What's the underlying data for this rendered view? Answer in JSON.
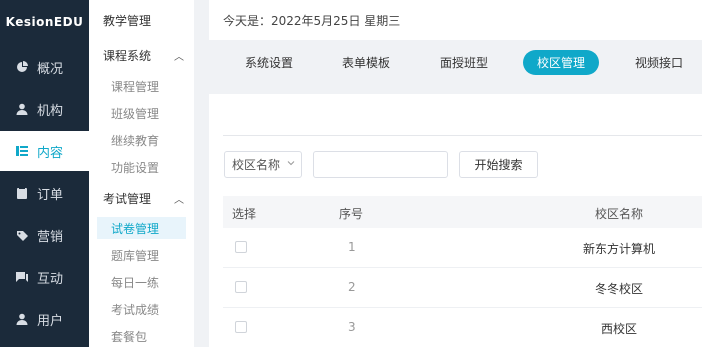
{
  "brand": "KesionEDU",
  "rail": [
    {
      "label": "概况",
      "icon": "dashboard-icon"
    },
    {
      "label": "机构",
      "icon": "user-icon"
    },
    {
      "label": "内容",
      "icon": "content-icon",
      "active": true
    },
    {
      "label": "订单",
      "icon": "order-icon"
    },
    {
      "label": "营销",
      "icon": "marketing-icon"
    },
    {
      "label": "互动",
      "icon": "chat-icon"
    },
    {
      "label": "用户",
      "icon": "user-icon"
    }
  ],
  "submenu": {
    "top_label": "教学管理",
    "groups": [
      {
        "label": "课程系统",
        "items": [
          "课程管理",
          "班级管理",
          "继续教育",
          "功能设置"
        ]
      },
      {
        "label": "考试管理",
        "items": [
          "试卷管理",
          "题库管理",
          "每日一练",
          "考试成绩",
          "套餐包"
        ]
      }
    ],
    "active_item": "试卷管理"
  },
  "datebar": {
    "text": "今天是：2022年5月25日 星期三"
  },
  "tabs": [
    {
      "label": "系统设置"
    },
    {
      "label": "表单模板"
    },
    {
      "label": "面授班型"
    },
    {
      "label": "校区管理",
      "active": true
    },
    {
      "label": "视频接口"
    }
  ],
  "filter": {
    "select_value": "校区名称",
    "input_placeholder": "",
    "search_button": "开始搜索"
  },
  "table": {
    "columns": [
      "选择",
      "序号",
      "校区名称"
    ],
    "rows": [
      {
        "index": "1",
        "name": "新东方计算机"
      },
      {
        "index": "2",
        "name": "冬冬校区"
      },
      {
        "index": "3",
        "name": "西校区"
      }
    ]
  },
  "colors": {
    "accent": "#10a8c9",
    "rail_bg": "#1b2a3a",
    "page_bg": "#f0f2f5"
  }
}
